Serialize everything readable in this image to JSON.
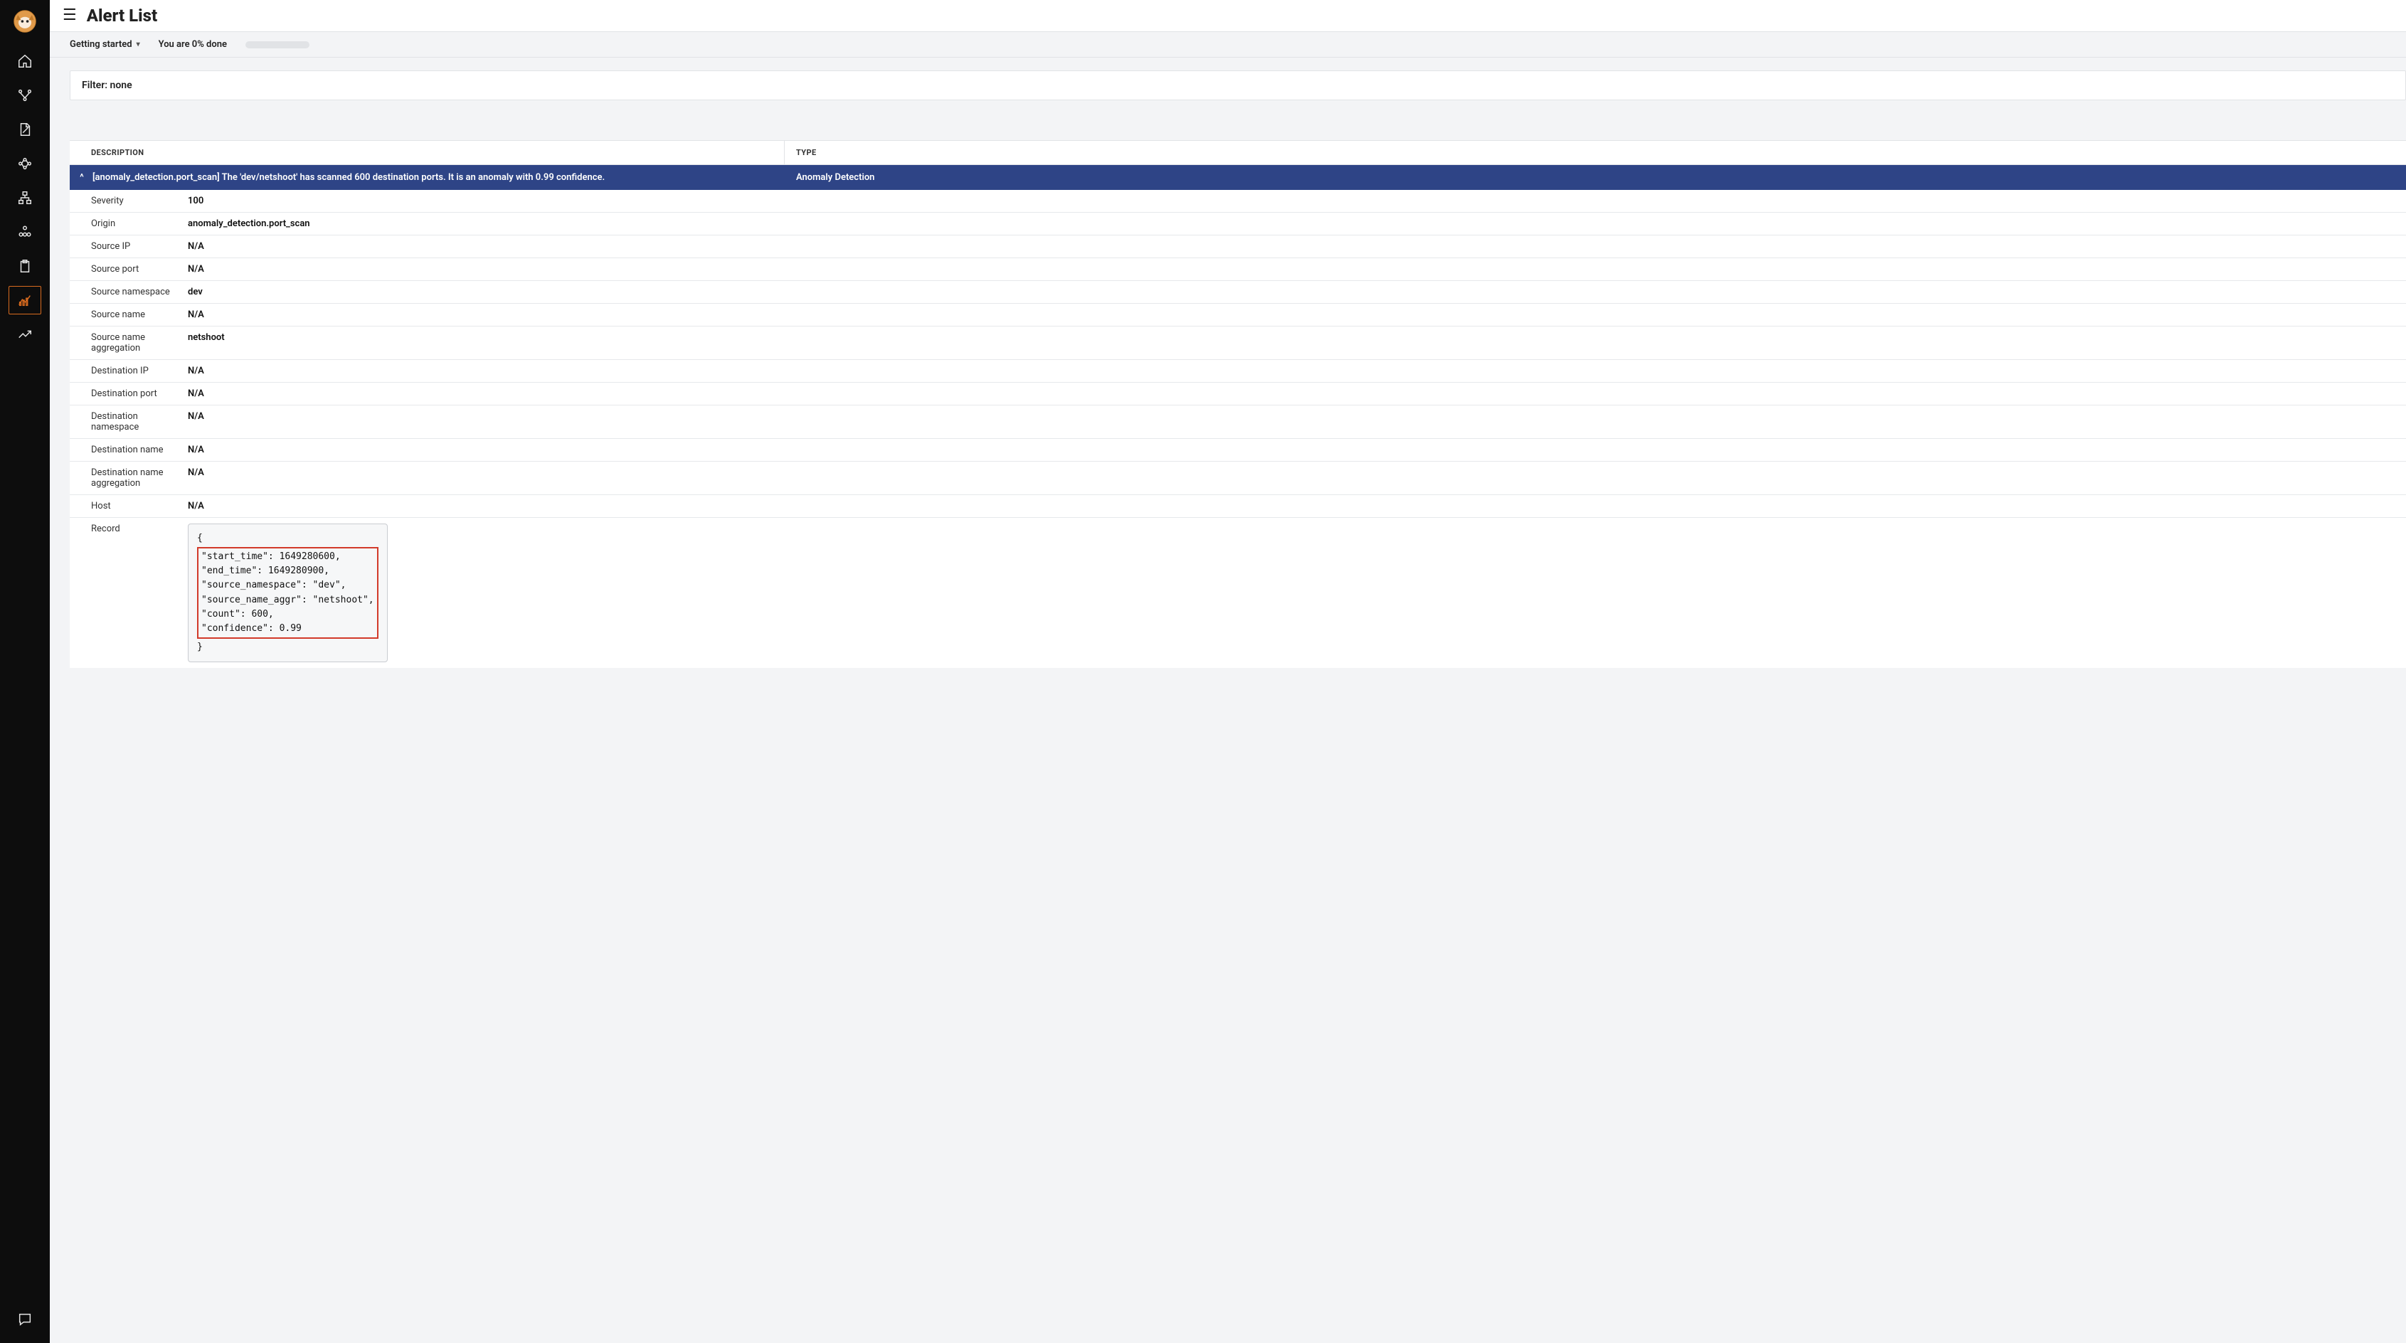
{
  "header": {
    "title": "Alert List"
  },
  "progress": {
    "getting_started": "Getting started",
    "status": "You are 0% done"
  },
  "filter": {
    "text": "Filter: none"
  },
  "table": {
    "head_description": "DESCRIPTION",
    "head_type": "TYPE"
  },
  "alert": {
    "description": "[anomaly_detection.port_scan] The 'dev/netshoot' has scanned 600 destination ports. It is an anomaly with 0.99 confidence.",
    "type": "Anomaly Detection"
  },
  "details": {
    "severity_label": "Severity",
    "severity_value": "100",
    "origin_label": "Origin",
    "origin_value": "anomaly_detection.port_scan",
    "source_ip_label": "Source IP",
    "source_ip_value": "N/A",
    "source_port_label": "Source port",
    "source_port_value": "N/A",
    "source_ns_label": "Source namespace",
    "source_ns_value": "dev",
    "source_name_label": "Source name",
    "source_name_value": "N/A",
    "source_aggr_label": "Source name aggregation",
    "source_aggr_value": "netshoot",
    "dest_ip_label": "Destination IP",
    "dest_ip_value": "N/A",
    "dest_port_label": "Destination port",
    "dest_port_value": "N/A",
    "dest_ns_label": "Destination namespace",
    "dest_ns_value": "N/A",
    "dest_name_label": "Destination name",
    "dest_name_value": "N/A",
    "dest_aggr_label": "Destination name aggregation",
    "dest_aggr_value": "N/A",
    "host_label": "Host",
    "host_value": "N/A",
    "record_label": "Record"
  },
  "record": {
    "open": "{",
    "body": "\"start_time\": 1649280600,\n\"end_time\": 1649280900,\n\"source_namespace\": \"dev\",\n\"source_name_aggr\": \"netshoot\",\n\"count\": 600,\n\"confidence\": 0.99",
    "close": "}"
  }
}
